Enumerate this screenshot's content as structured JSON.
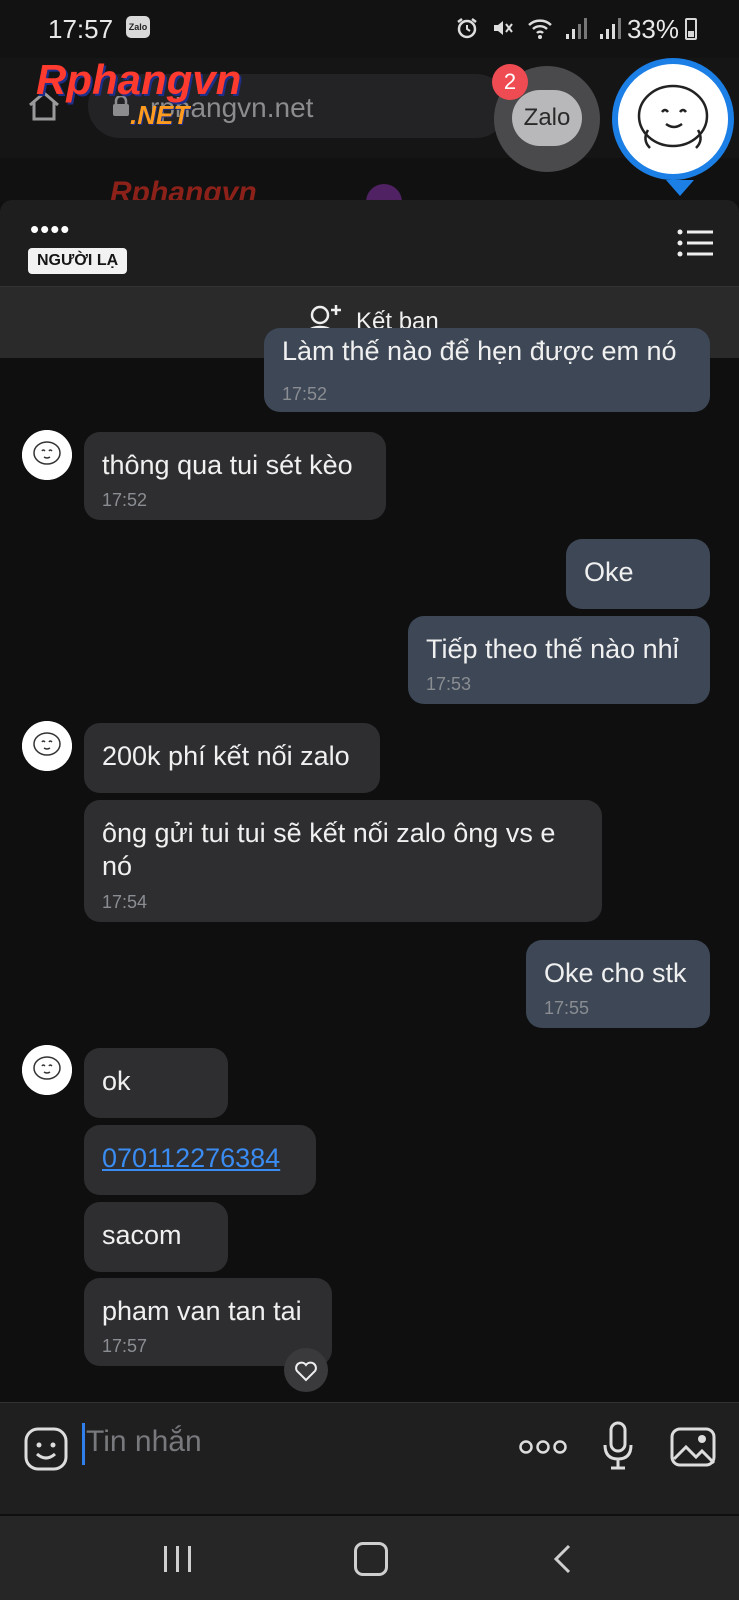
{
  "status_bar": {
    "time": "17:57",
    "notification_app": "Zalo",
    "battery": "33%",
    "icons": [
      "alarm-icon",
      "mute-icon",
      "wifi-icon",
      "signal-icon",
      "signal-icon"
    ]
  },
  "browser": {
    "url": "rphangvn.net",
    "logo_main": "Rphangvn",
    "logo_sub": ".NET",
    "strip_logo": "Rphangvn"
  },
  "floating": {
    "zalo_label": "Zalo",
    "zalo_badge": "2"
  },
  "chat": {
    "contact_name": "••••",
    "contact_tag": "NGƯỜI LẠ",
    "add_friend_label": "Kết bạn",
    "messages": [
      {
        "dir": "out",
        "text": "Làm thế nào để hẹn được em nó",
        "time": "17:52"
      },
      {
        "dir": "in",
        "text": "thông qua tui sét kèo",
        "time": "17:52"
      },
      {
        "dir": "out",
        "text": "Oke",
        "time": ""
      },
      {
        "dir": "out",
        "text": "Tiếp theo thế nào nhỉ",
        "time": "17:53"
      },
      {
        "dir": "in",
        "text": "200k phí kết nối zalo",
        "time": ""
      },
      {
        "dir": "in",
        "text_line1": "ông gửi tui tui sẽ kết nối zalo ông vs e",
        "text_line2": "nó",
        "time": "17:54"
      },
      {
        "dir": "out",
        "text": "Oke cho stk",
        "time": "17:55"
      },
      {
        "dir": "in",
        "text": "ok",
        "time": ""
      },
      {
        "dir": "in",
        "text": "070112276384",
        "time": ""
      },
      {
        "dir": "in",
        "text": "sacom",
        "time": ""
      },
      {
        "dir": "in",
        "text": "pham van tan tai",
        "time": "17:57"
      }
    ]
  },
  "composer": {
    "placeholder": "Tin nhắn"
  },
  "colors": {
    "background": "#0f0f10",
    "incoming_bubble": "#2e2e30",
    "outgoing_bubble": "#3d4755",
    "link": "#3a8cf2",
    "accent_blue": "#1b7fe6",
    "badge_red": "#ef4b52"
  }
}
